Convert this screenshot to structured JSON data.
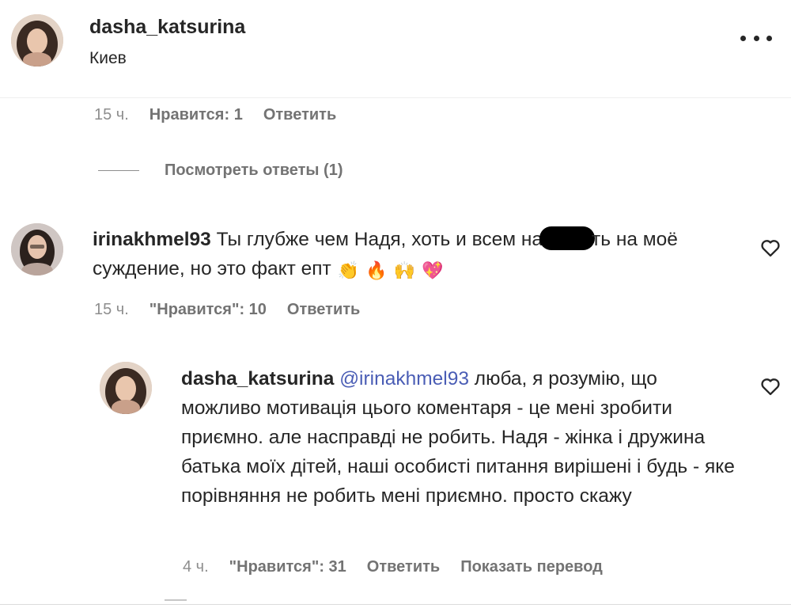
{
  "post_header": {
    "username": "dasha_katsurina",
    "location": "Киев",
    "more_icon": "more-horizontal-icon"
  },
  "first_comment_meta": {
    "time": "15 ч.",
    "likes": "Нравится: 1",
    "reply": "Ответить"
  },
  "view_replies": "Посмотреть ответы (1)",
  "comment2": {
    "username": "irinakhmel93",
    "text_before": "Ты глубже чем Надя, хоть и всем на",
    "text_after": "ть на моё суждение, но это факт епт",
    "emojis": [
      "👏",
      "🔥",
      "🙌",
      "💖"
    ],
    "time": "15 ч.",
    "likes": "\"Нравится\": 10",
    "reply": "Ответить"
  },
  "reply1": {
    "username": "dasha_katsurina",
    "mention": "@irinakhmel93",
    "text": "люба, я розумію, що можливо мотивація цього коментаря - це мені зробити приємно. але насправді не робить. Надя - жінка і дружина батька моїх дітей, наші особисті питання вирішені і будь - яке порівняння не робить мені приємно. просто скажу",
    "time": "4 ч.",
    "likes": "\"Нравится\": 31",
    "reply": "Ответить",
    "translate": "Показать перевод"
  },
  "colors": {
    "text": "#262626",
    "secondary": "#8e8e8e",
    "mention": "#4a5db5"
  }
}
